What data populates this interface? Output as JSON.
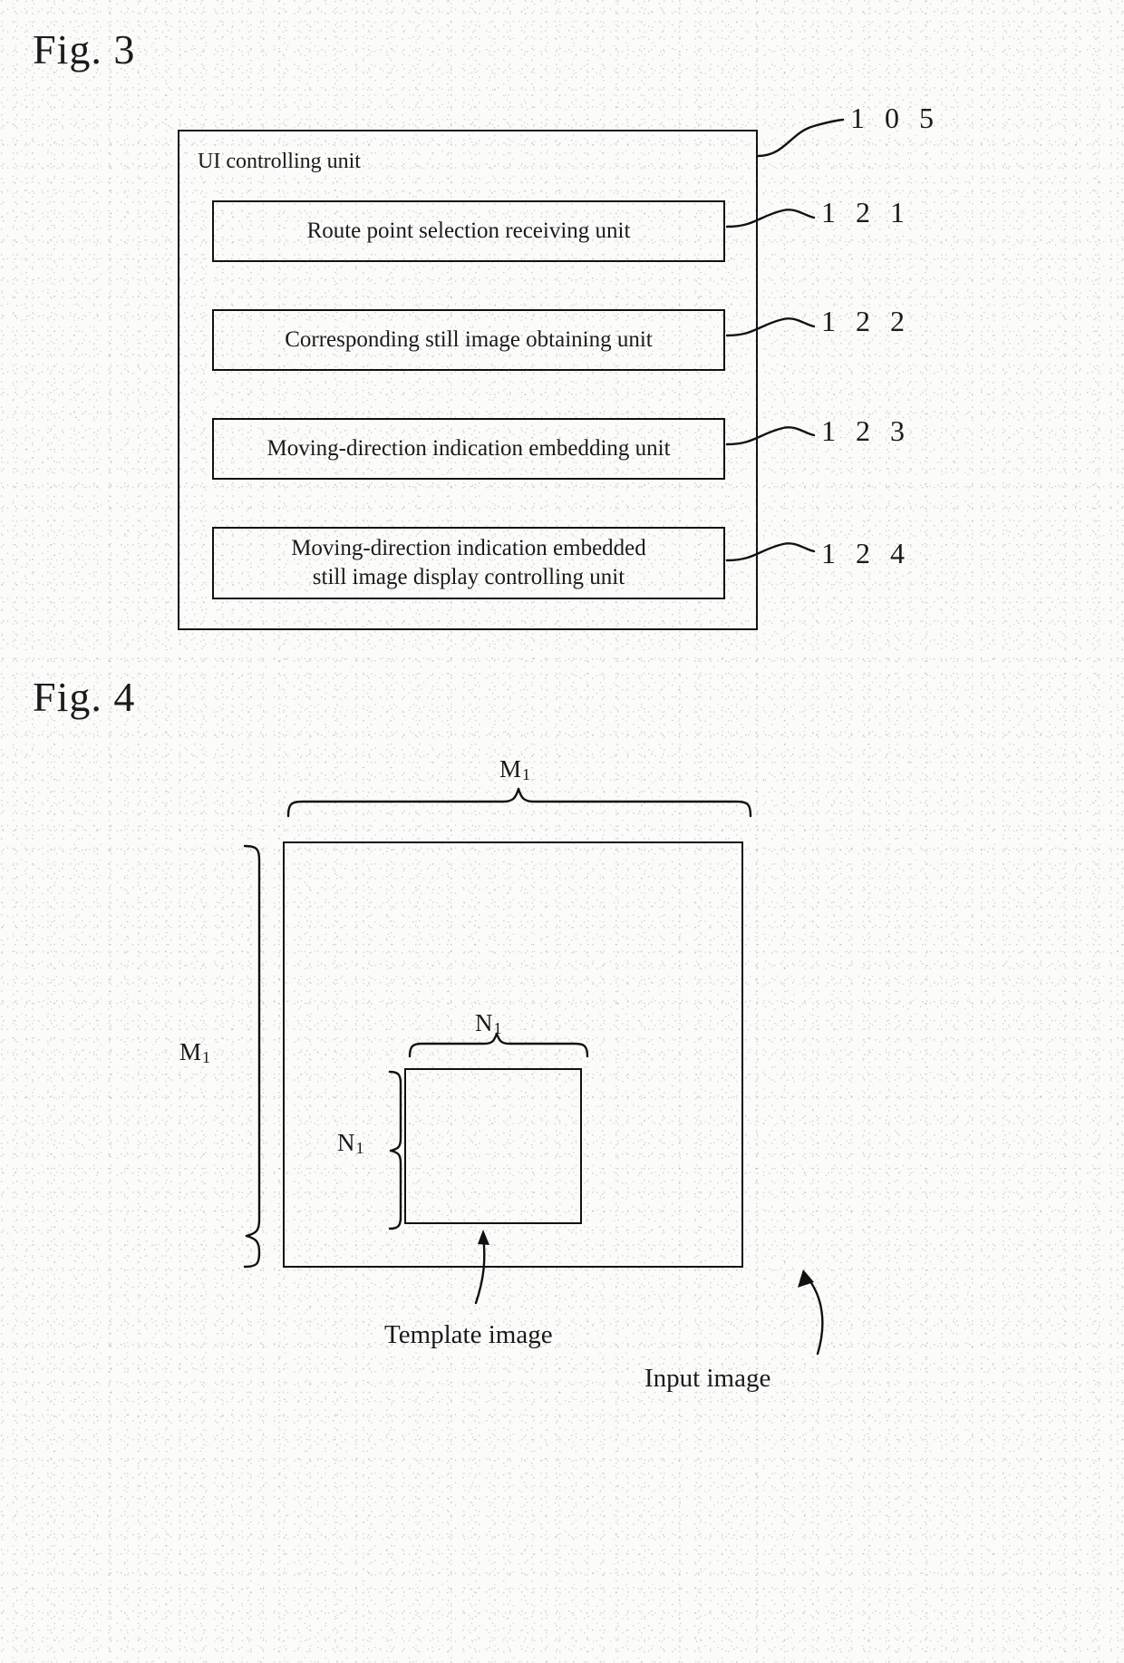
{
  "figures": {
    "fig3": {
      "title": "Fig. 3",
      "outer": {
        "label": "UI controlling unit",
        "ref": "1 0 5"
      },
      "blocks": [
        {
          "label": "Route point selection receiving unit",
          "ref": "1 2 1"
        },
        {
          "label": "Corresponding still image obtaining unit",
          "ref": "1 2 2"
        },
        {
          "label": "Moving-direction indication embedding unit",
          "ref": "1 2 3"
        },
        {
          "label_line1": "Moving-direction indication embedded",
          "label_line2": "still image display controlling unit",
          "ref": "1 2 4"
        }
      ]
    },
    "fig4": {
      "title": "Fig. 4",
      "dimensions": {
        "outer_top": "M",
        "outer_top_sub": "1",
        "outer_left": "M",
        "outer_left_sub": "1",
        "inner_top": "N",
        "inner_top_sub": "1",
        "inner_left": "N",
        "inner_left_sub": "1"
      },
      "callouts": {
        "template": "Template image",
        "input": "Input image"
      }
    }
  },
  "style": {
    "ink": "#111111",
    "paper": "#fbfbfa"
  }
}
